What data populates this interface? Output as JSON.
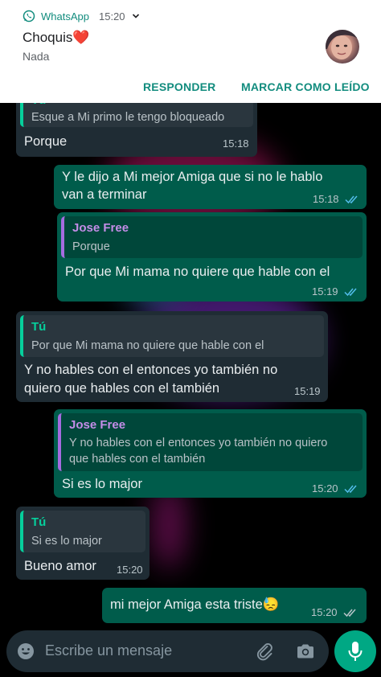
{
  "notification": {
    "app_name": "WhatsApp",
    "time": "15:20",
    "sender": "Choquis❤️",
    "text": "Nada",
    "actions": [
      "RESPONDER",
      "MARCAR COMO LEÍDO"
    ]
  },
  "messages": [
    {
      "dir": "in",
      "quote_author": "Tú",
      "quote_text": "Esque a Mi primo le tengo bloqueado",
      "text": "Porque",
      "time": "15:18"
    },
    {
      "dir": "out",
      "text_lines": [
        "Y le dijo a Mi mejor Amiga que si no le hablo",
        "van a terminar"
      ],
      "time": "15:18"
    },
    {
      "dir": "out",
      "quote_author": "Jose Free",
      "quote_text": "Porque",
      "text": "Por que Mi mama no quiere que hable con el",
      "time": "15:19"
    },
    {
      "dir": "in",
      "quote_author": "Tú",
      "quote_text": "Por que Mi mama no quiere que hable con el",
      "text_lines": [
        "Y no hables con el entonces yo también no",
        "quiero que hables con el también"
      ],
      "time": "15:19"
    },
    {
      "dir": "out",
      "quote_author": "Jose Free",
      "quote_text_lines": [
        "Y no hables con el entonces yo también no quiero",
        "que hables con el también"
      ],
      "text": "Si es lo major",
      "time": "15:20"
    },
    {
      "dir": "in",
      "quote_author": "Tú",
      "quote_text": "Si es lo major",
      "text": "Bueno amor",
      "time": "15:20"
    },
    {
      "dir": "out",
      "text": "mi mejor Amiga esta triste😓",
      "time": "15:20"
    }
  ],
  "composer": {
    "placeholder": "Escribe un mensaje"
  },
  "colors": {
    "incoming_bubble": "#1f2c34",
    "outgoing_bubble": "#005c4b",
    "accent": "#00a884",
    "read_ticks": "#53bdeb"
  }
}
